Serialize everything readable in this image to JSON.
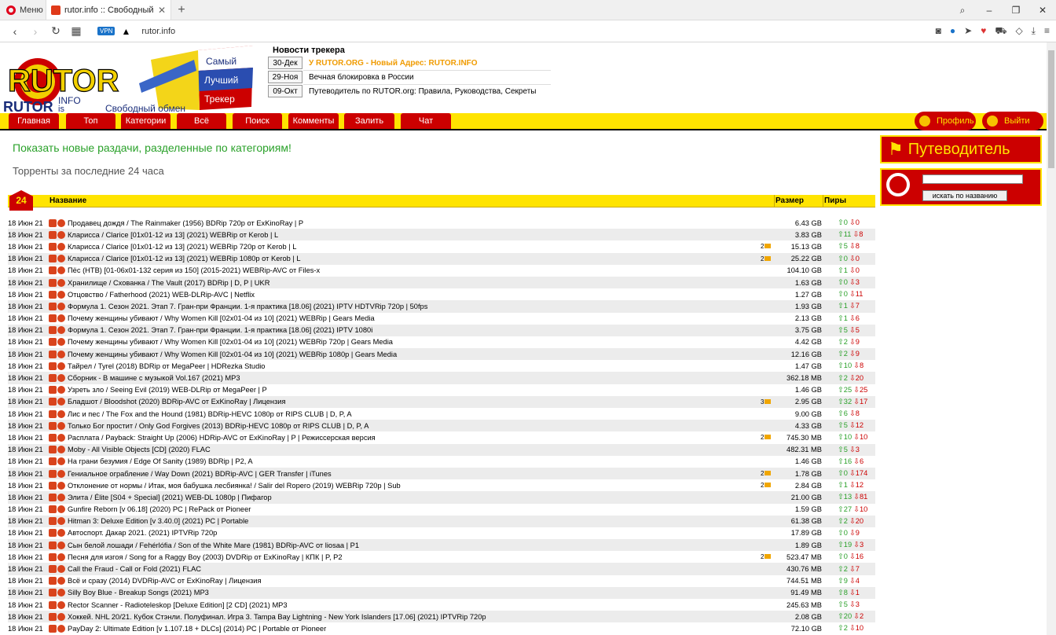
{
  "browser": {
    "menu_label": "Меню",
    "tab_title": "rutor.info :: Свободный тор",
    "url": "rutor.info",
    "vpn": "VPN"
  },
  "site": {
    "logo": {
      "line1": "RUTOR",
      "line2": "INFO",
      "line3": "is",
      "slogan1": "Самый",
      "slogan2": "Лучший",
      "slogan3": "Трекер",
      "tagline": "Свободный обмен"
    },
    "news_title": "Новости трекера",
    "news": [
      {
        "date": "30-Дек",
        "text": "У RUTOR.ORG - Новый Адрес: RUTOR.INFO"
      },
      {
        "date": "29-Ноя",
        "text": "Вечная блокировка в России"
      },
      {
        "date": "09-Окт",
        "text": "Путеводитель по RUTOR.org: Правила, Руководства, Секреты"
      }
    ],
    "menu": [
      "Главная",
      "Топ",
      "Категории",
      "Всё",
      "Поиск",
      "Комменты",
      "Залить",
      "Чат"
    ],
    "profile": "Профиль",
    "logout": "Выйти",
    "green_title": "Показать новые раздачи, разделенные по категориям!",
    "gray_title": "Торренты за последние 24 часа",
    "guide": "Путеводитель",
    "search_button": "искать по названию",
    "badge": "24",
    "col_name": "Название",
    "col_size": "Размер",
    "col_peers": "Пиры"
  },
  "rows": [
    {
      "date": "18 Июн 21",
      "title": "Продавец дождя / The Rainmaker (1956) BDRip 720p от ExKinoRay | P",
      "com": "",
      "size": "6.43 GB",
      "up": "0",
      "dn": "0"
    },
    {
      "date": "18 Июн 21",
      "title": "Кларисса / Clarice [01x01-12 из 13] (2021) WEBRip от Kerob | L",
      "com": "",
      "size": "3.83 GB",
      "up": "11",
      "dn": "8"
    },
    {
      "date": "18 Июн 21",
      "title": "Кларисса / Clarice [01x01-12 из 13] (2021) WEBRip 720p от Kerob | L",
      "com": "2",
      "size": "15.13 GB",
      "up": "5",
      "dn": "8"
    },
    {
      "date": "18 Июн 21",
      "title": "Кларисса / Clarice [01x01-12 из 13] (2021) WEBRip 1080p от Kerob | L",
      "com": "2",
      "size": "25.22 GB",
      "up": "0",
      "dn": "0"
    },
    {
      "date": "18 Июн 21",
      "title": "Пёс (НТВ) [01-06x01-132 серия из 150] (2015-2021) WEBRip-AVC от Files-x",
      "com": "",
      "size": "104.10 GB",
      "up": "1",
      "dn": "0"
    },
    {
      "date": "18 Июн 21",
      "title": "Хранилище / Схованка / The Vault (2017) BDRip | D, P | UKR",
      "com": "",
      "size": "1.63 GB",
      "up": "0",
      "dn": "3"
    },
    {
      "date": "18 Июн 21",
      "title": "Отцовство / Fatherhood (2021) WEB-DLRip-AVC | Netflix",
      "com": "",
      "size": "1.27 GB",
      "up": "0",
      "dn": "11"
    },
    {
      "date": "18 Июн 21",
      "title": "Формула 1. Сезон 2021. Этап 7. Гран-при Франции. 1-я практика [18.06] (2021) IPTV HDTVRip 720p | 50fps",
      "com": "",
      "size": "1.93 GB",
      "up": "1",
      "dn": "7"
    },
    {
      "date": "18 Июн 21",
      "title": "Почему женщины убивают / Why Women Kill [02x01-04 из 10] (2021) WEBRip | Gears Media",
      "com": "",
      "size": "2.13 GB",
      "up": "1",
      "dn": "6"
    },
    {
      "date": "18 Июн 21",
      "title": "Формула 1. Сезон 2021. Этап 7. Гран-при Франции. 1-я практика [18.06] (2021) IPTV 1080i",
      "com": "",
      "size": "3.75 GB",
      "up": "5",
      "dn": "5"
    },
    {
      "date": "18 Июн 21",
      "title": "Почему женщины убивают / Why Women Kill [02x01-04 из 10] (2021) WEBRip 720p | Gears Media",
      "com": "",
      "size": "4.42 GB",
      "up": "2",
      "dn": "9"
    },
    {
      "date": "18 Июн 21",
      "title": "Почему женщины убивают / Why Women Kill [02x01-04 из 10] (2021) WEBRip 1080p | Gears Media",
      "com": "",
      "size": "12.16 GB",
      "up": "2",
      "dn": "9"
    },
    {
      "date": "18 Июн 21",
      "title": "Тайрел / Tyrel (2018) BDRip от MegaPeer | HDRezka Studio",
      "com": "",
      "size": "1.47 GB",
      "up": "10",
      "dn": "8"
    },
    {
      "date": "18 Июн 21",
      "title": "Сборник - В машине с музыкой Vol.167 (2021) MP3",
      "com": "",
      "size": "362.18 MB",
      "up": "2",
      "dn": "20"
    },
    {
      "date": "18 Июн 21",
      "title": "Узреть зло / Seeing Evil (2019) WEB-DLRip от MegaPeer | P",
      "com": "",
      "size": "1.46 GB",
      "up": "25",
      "dn": "25"
    },
    {
      "date": "18 Июн 21",
      "title": "Бладшот / Bloodshot (2020) BDRip-AVC от ExKinoRay | Лицензия",
      "com": "3",
      "size": "2.95 GB",
      "up": "32",
      "dn": "17"
    },
    {
      "date": "18 Июн 21",
      "title": "Лис и пес / The Fox and the Hound (1981) BDRip-HEVC 1080p от RIPS CLUB | D, P, A",
      "com": "",
      "size": "9.00 GB",
      "up": "6",
      "dn": "8"
    },
    {
      "date": "18 Июн 21",
      "title": "Только Бог простит / Only God Forgives (2013) BDRip-HEVC 1080p от RIPS CLUB | D, P, A",
      "com": "",
      "size": "4.33 GB",
      "up": "5",
      "dn": "12"
    },
    {
      "date": "18 Июн 21",
      "title": "Расплата / Payback: Straight Up (2006) HDRip-AVC от ExKinoRay | P | Режиссерская версия",
      "com": "2",
      "size": "745.30 MB",
      "up": "10",
      "dn": "10"
    },
    {
      "date": "18 Июн 21",
      "title": "Moby - All Visible Objects [CD] (2020) FLAC",
      "com": "",
      "size": "482.31 MB",
      "up": "5",
      "dn": "3"
    },
    {
      "date": "18 Июн 21",
      "title": "На грани безумия / Edge Of Sanity (1989) BDRip | P2, A",
      "com": "",
      "size": "1.46 GB",
      "up": "16",
      "dn": "6"
    },
    {
      "date": "18 Июн 21",
      "title": "Гениальное ограбление / Way Down (2021) BDRip-AVC | GER Transfer | iTunes",
      "com": "2",
      "size": "1.78 GB",
      "up": "0",
      "dn": "174"
    },
    {
      "date": "18 Июн 21",
      "title": "Отклонение от нормы / Итак, моя бабушка лесбиянка! / Salir del Ropero (2019) WEBRip 720p | Sub",
      "com": "2",
      "size": "2.84 GB",
      "up": "1",
      "dn": "12"
    },
    {
      "date": "18 Июн 21",
      "title": "Элита / Élite [S04 + Special] (2021) WEB-DL 1080p | Пифагор",
      "com": "",
      "size": "21.00 GB",
      "up": "13",
      "dn": "81"
    },
    {
      "date": "18 Июн 21",
      "title": "Gunfire Reborn [v 06.18] (2020) PC | RePack от Pioneer",
      "com": "",
      "size": "1.59 GB",
      "up": "27",
      "dn": "10"
    },
    {
      "date": "18 Июн 21",
      "title": "Hitman 3: Deluxe Edition [v 3.40.0] (2021) PC | Portable",
      "com": "",
      "size": "61.38 GB",
      "up": "2",
      "dn": "20"
    },
    {
      "date": "18 Июн 21",
      "title": "Автоспорт. Дакар 2021. (2021) IPTVRip 720p",
      "com": "",
      "size": "17.89 GB",
      "up": "0",
      "dn": "9"
    },
    {
      "date": "18 Июн 21",
      "title": "Сын белой лошади / Fehérlófia / Son of the White Mare (1981) BDRip-AVC от liosaa | P1",
      "com": "",
      "size": "1.89 GB",
      "up": "19",
      "dn": "3"
    },
    {
      "date": "18 Июн 21",
      "title": "Песня для изгоя / Song for a Raggy Boy (2003) DVDRip от ExKinoRay | КПК | P, P2",
      "com": "2",
      "size": "523.47 MB",
      "up": "0",
      "dn": "16"
    },
    {
      "date": "18 Июн 21",
      "title": "Call the Fraud - Call or Fold (2021) FLAC",
      "com": "",
      "size": "430.76 MB",
      "up": "2",
      "dn": "7"
    },
    {
      "date": "18 Июн 21",
      "title": "Всё и сразу (2014) DVDRip-AVC от ExKinoRay | Лицензия",
      "com": "",
      "size": "744.51 MB",
      "up": "9",
      "dn": "4"
    },
    {
      "date": "18 Июн 21",
      "title": "Silly Boy Blue - Breakup Songs (2021) MP3",
      "com": "",
      "size": "91.49 MB",
      "up": "8",
      "dn": "1"
    },
    {
      "date": "18 Июн 21",
      "title": "Rector Scanner - Radioteleskop [Deluxe Edition] [2 CD] (2021) MP3",
      "com": "",
      "size": "245.63 MB",
      "up": "5",
      "dn": "3"
    },
    {
      "date": "18 Июн 21",
      "title": "Хоккей. NHL 20/21. Кубок Стэнли. Полуфинал. Игра 3. Tampa Bay Lightning - New York Islanders [17.06] (2021) IPTVRip 720p",
      "com": "",
      "size": "2.08 GB",
      "up": "20",
      "dn": "2"
    },
    {
      "date": "18 Июн 21",
      "title": "PayDay 2: Ultimate Edition [v 1.107.18 + DLCs] (2014) PC | Portable от Pioneer",
      "com": "",
      "size": "72.10 GB",
      "up": "2",
      "dn": "10"
    }
  ]
}
